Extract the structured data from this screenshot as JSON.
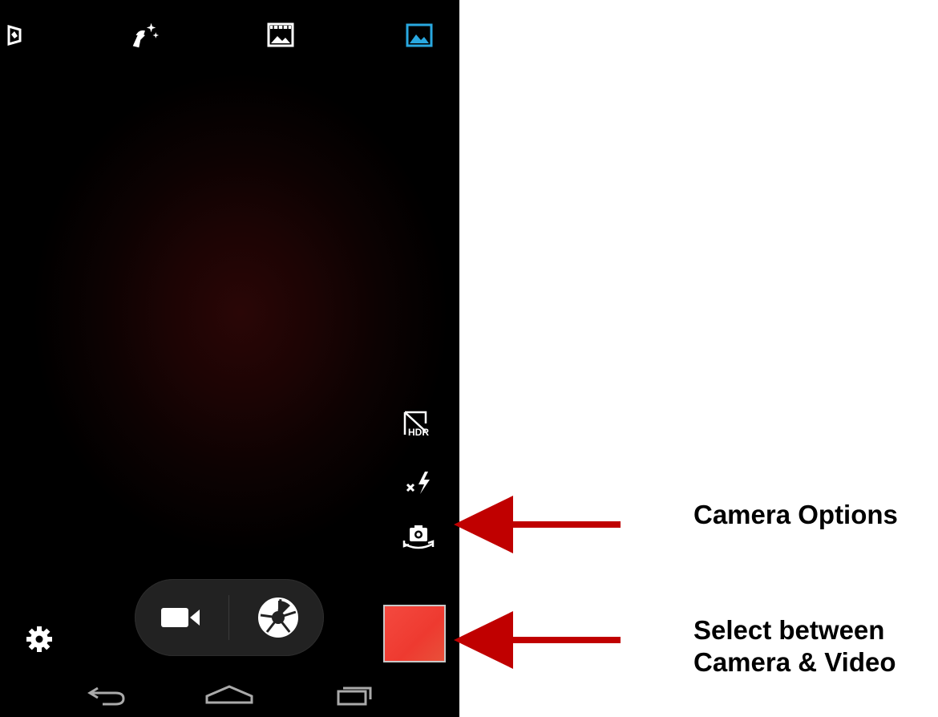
{
  "camera_app": {
    "top_bar": {
      "icons": [
        "panorama-icon",
        "effects-wand-icon",
        "scene-mode-icon",
        "gallery-picture-icon"
      ],
      "active_color": "#29a8e0"
    },
    "side_options": {
      "icons": [
        "hdr-off-icon",
        "flash-off-icon",
        "switch-camera-icon"
      ],
      "hdr_label": "HDR"
    },
    "mode_switcher": {
      "modes": [
        "video-camera-icon",
        "shutter-icon"
      ]
    },
    "thumbnail_color": "#f4493f",
    "navigation_bar": {
      "icons": [
        "back-icon",
        "home-icon",
        "recent-apps-icon"
      ]
    }
  },
  "annotations": [
    {
      "label": "Camera Options",
      "color": "#c00000"
    },
    {
      "label_line1": "Select between",
      "label_line2": "Camera & Video",
      "color": "#c00000"
    }
  ]
}
